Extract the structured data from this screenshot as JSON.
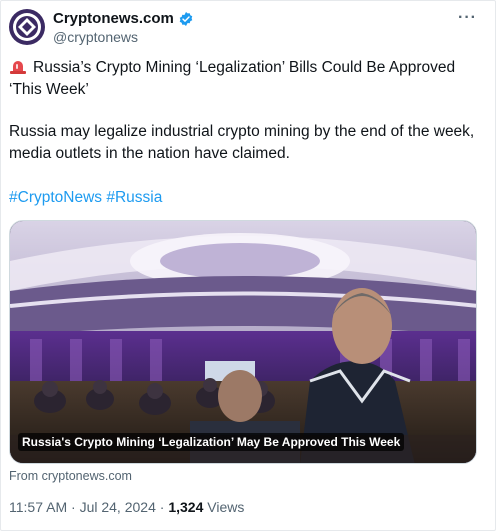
{
  "account": {
    "display_name": "Cryptonews.com",
    "handle": "@cryptonews"
  },
  "header": {
    "more_label": "···"
  },
  "tweet": {
    "headline": "Russia’s Crypto Mining ‘Legalization’ Bills Could Be Approved ‘This Week’",
    "body": "Russia may legalize industrial crypto mining by the end of the week, media outlets in the nation have claimed.",
    "hashtags": [
      "#CryptoNews",
      "#Russia"
    ]
  },
  "media": {
    "caption": "Russia's Crypto Mining ‘Legalization’ May Be Approved This Week",
    "source": "From cryptonews.com"
  },
  "meta": {
    "time": "11:57 AM",
    "separator": " · ",
    "date": "Jul 24, 2024",
    "views_count": "1,324",
    "views_label": " Views"
  },
  "colors": {
    "link": "#1d9bf0",
    "verified": "#1d9bf0",
    "secondary_text": "#536471",
    "avatar_bg": "#3b2a63"
  },
  "icons": {
    "avatar": "cryptonews-logo",
    "verified": "verified-badge-icon",
    "headline": "siren-icon"
  }
}
